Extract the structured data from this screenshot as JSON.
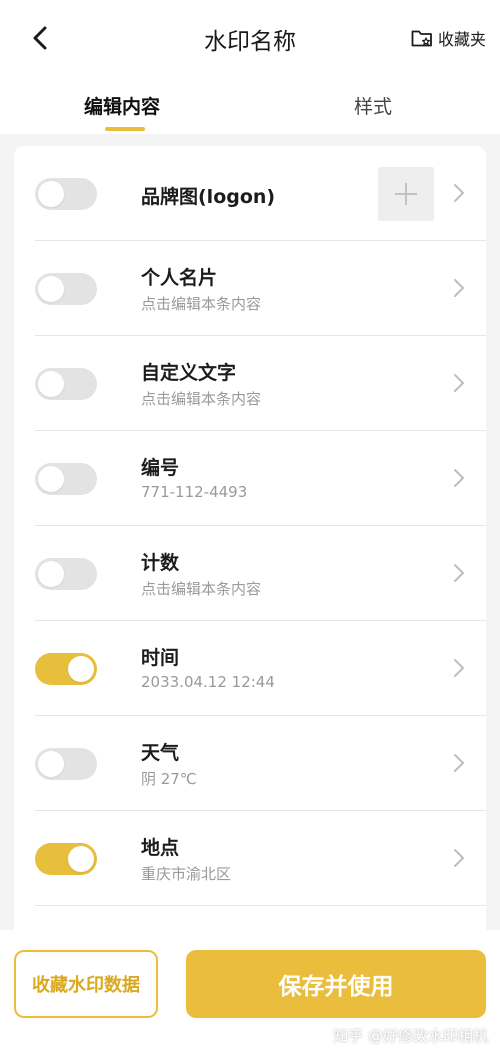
{
  "header": {
    "title": "水印名称",
    "favorites_label": "收藏夹",
    "back_icon": "back-arrow-icon",
    "favorites_icon": "folder-star-icon"
  },
  "tabs": [
    {
      "label": "编辑内容",
      "active": true
    },
    {
      "label": "样式",
      "active": false
    }
  ],
  "rows": [
    {
      "title": "品牌图(logon)",
      "subtitle": "",
      "enabled": false,
      "has_add_button": true
    },
    {
      "title": "个人名片",
      "subtitle": "点击编辑本条内容",
      "enabled": false
    },
    {
      "title": "自定义文字",
      "subtitle": "点击编辑本条内容",
      "enabled": false
    },
    {
      "title": "编号",
      "subtitle": "771-112-4493",
      "enabled": false
    },
    {
      "title": "计数",
      "subtitle": "点击编辑本条内容",
      "enabled": false
    },
    {
      "title": "时间",
      "subtitle": "2033.04.12 12:44",
      "enabled": true
    },
    {
      "title": "天气",
      "subtitle": "阴 27℃",
      "enabled": false
    },
    {
      "title": "地点",
      "subtitle": "重庆市渝北区",
      "enabled": true
    }
  ],
  "footer": {
    "collect_label": "收藏水印数据",
    "save_label": "保存并使用"
  },
  "watermark": "知乎 @好修改水印相机",
  "colors": {
    "accent": "#eabd3c",
    "toggle_off": "#e3e3e3",
    "background": "#f4f4f4"
  }
}
